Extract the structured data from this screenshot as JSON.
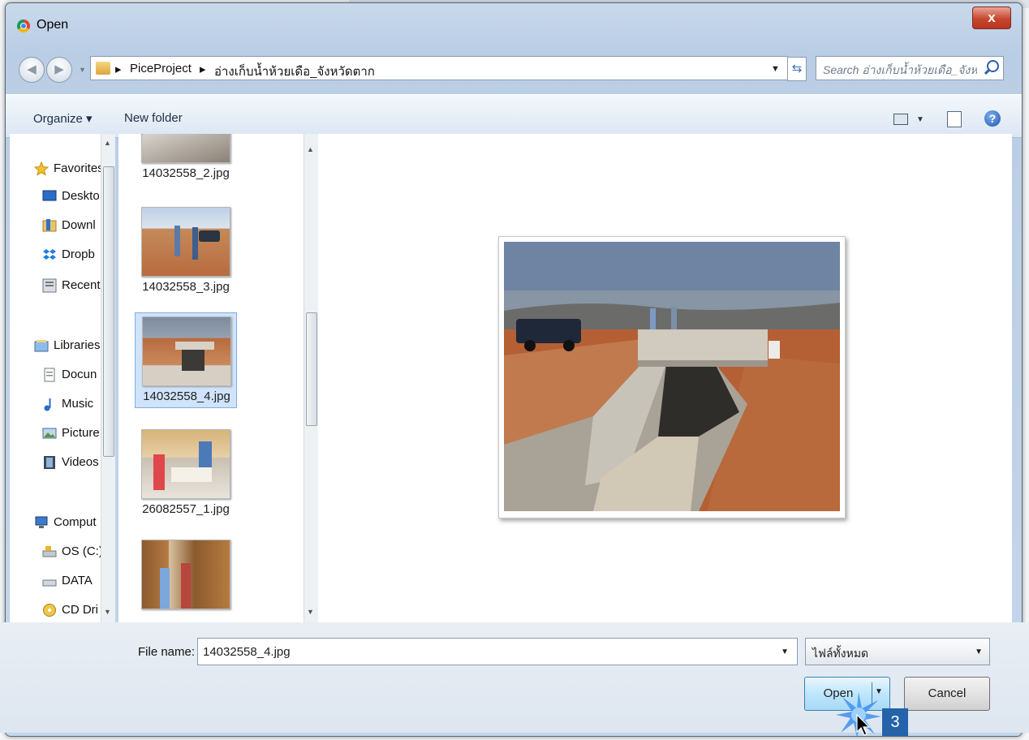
{
  "window": {
    "title": "Open",
    "close_label": "x"
  },
  "address": {
    "crumbs": [
      "PiceProject",
      "อ่างเก็บน้ำห้วยเดือ_จังหวัดตาก"
    ],
    "separator": "▸",
    "search_placeholder": "Search อ่างเก็บน้ำห้วยเดือ_จังหวั..."
  },
  "toolbar": {
    "organize": "Organize ▾",
    "new_folder": "New folder"
  },
  "nav": {
    "items": [
      {
        "label": "Favorites",
        "icon": "star-icon"
      },
      {
        "label": "Deskto",
        "icon": "desktop-icon"
      },
      {
        "label": "Downl",
        "icon": "downloads-icon"
      },
      {
        "label": "Dropb",
        "icon": "dropbox-icon"
      },
      {
        "label": "Recent",
        "icon": "recent-places-icon"
      },
      {
        "label": "Libraries",
        "icon": "libraries-icon"
      },
      {
        "label": "Docun",
        "icon": "documents-icon"
      },
      {
        "label": "Music",
        "icon": "music-icon"
      },
      {
        "label": "Picture",
        "icon": "pictures-icon"
      },
      {
        "label": "Videos",
        "icon": "videos-icon"
      },
      {
        "label": "Comput",
        "icon": "computer-icon"
      },
      {
        "label": "OS (C:)",
        "icon": "drive-icon"
      },
      {
        "label": "DATA",
        "icon": "drive-icon"
      },
      {
        "label": "CD Dri",
        "icon": "cd-drive-icon"
      }
    ]
  },
  "files": [
    {
      "name": "14032558_2.jpg",
      "selected": false
    },
    {
      "name": "14032558_3.jpg",
      "selected": false
    },
    {
      "name": "14032558_4.jpg",
      "selected": true
    },
    {
      "name": "26082557_1.jpg",
      "selected": false
    },
    {
      "name": ""
    }
  ],
  "bottom": {
    "file_name_label": "File name:",
    "file_name_value": "14032558_4.jpg",
    "file_type": "ไฟล์ทั้งหมด",
    "open_label": "Open",
    "cancel_label": "Cancel"
  },
  "annotation": {
    "step": "3"
  },
  "colors": {
    "accent": "#2462aa",
    "selection": "#cfe4fa",
    "close": "#c7462f"
  }
}
